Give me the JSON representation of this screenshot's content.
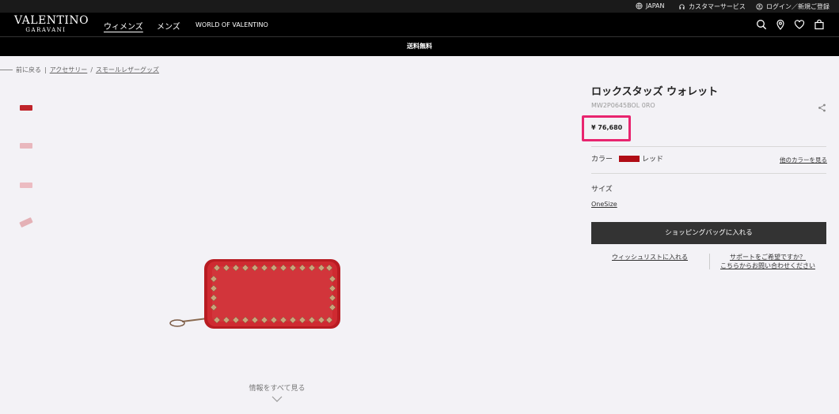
{
  "utility_bar": {
    "region": "JAPAN",
    "customer_service": "カスタマーサービス",
    "login": "ログイン／新規ご登録"
  },
  "nav": {
    "logo_line1": "VALENTINO",
    "logo_line2": "GARAVANI",
    "links": [
      "ウィメンズ",
      "メンズ",
      "WORLD OF VALENTINO"
    ],
    "active_link": "ウィメンズ",
    "icons": [
      "search-icon",
      "location-icon",
      "heart-icon",
      "bag-icon"
    ]
  },
  "promo": {
    "text": "送料無料"
  },
  "breadcrumb": {
    "back": "前に戻る",
    "items": [
      "アクセサリー",
      "スモールレザーグッズ"
    ]
  },
  "gallery": {
    "thumbnails": [
      {
        "color": "#c0242a"
      },
      {
        "color": "#e9b7bd"
      },
      {
        "color": "#ecbcc2"
      },
      {
        "color": "#e4b1b6"
      }
    ],
    "see_all": "情報をすべて見る"
  },
  "product": {
    "title": "ロックスタッズ ウォレット",
    "code": "MW2P0645BOL 0RO",
    "price": "¥ 76,680",
    "color_label": "カラー",
    "color_name": "レッド",
    "color_swatch": "#b00c15",
    "other_colors": "他のカラーを見る",
    "size_label": "サイズ",
    "size_option": "OneSize",
    "add_to_bag": "ショッピングバッグに入れる",
    "wishlist": "ウィッシュリストに入れる",
    "support_line1": "サポートをご希望ですか？",
    "support_line2": "こちらからお問い合わせください"
  },
  "colors": {
    "highlight": "#e8256f",
    "button": "#333333",
    "header": "#000000"
  }
}
